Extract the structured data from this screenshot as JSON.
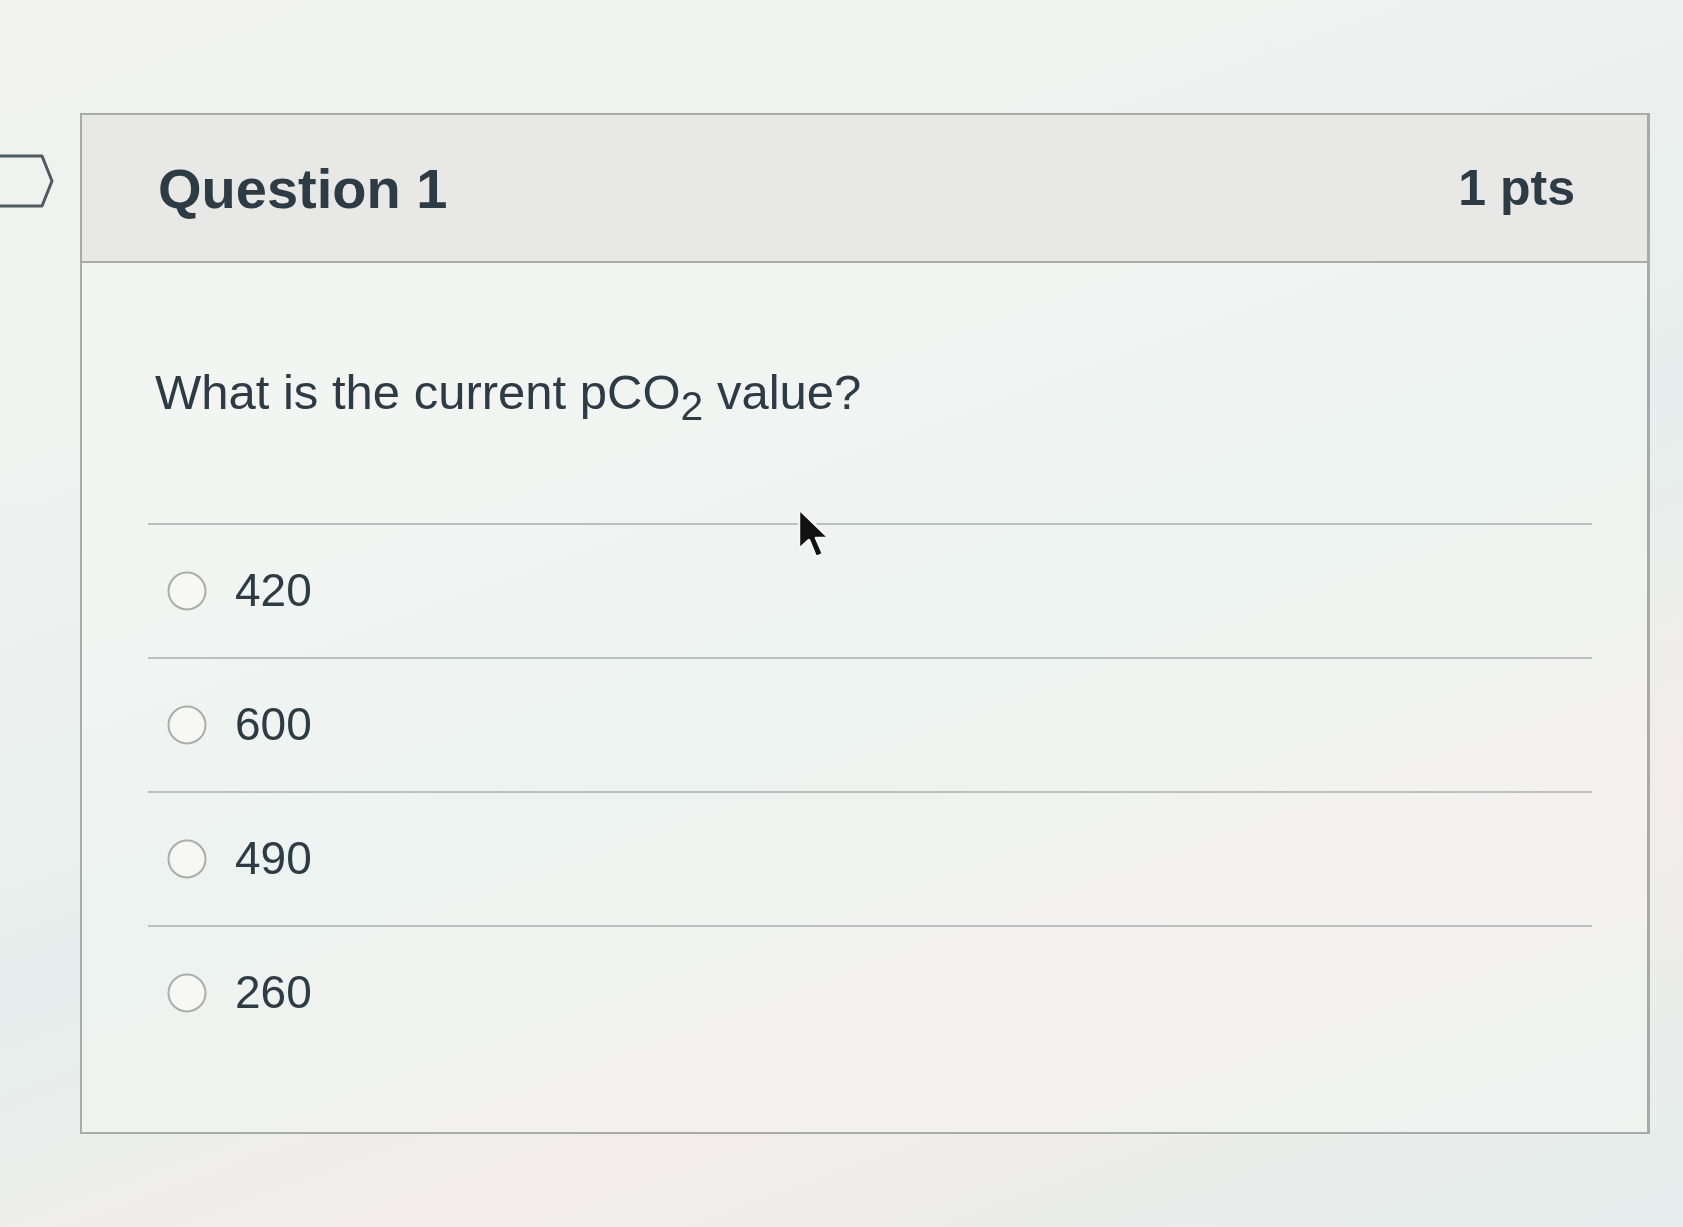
{
  "question": {
    "title": "Question 1",
    "points": "1 pts",
    "text": "What is the current pCO$_{2}$ value?",
    "answers": [
      {
        "label": "420",
        "selected": false
      },
      {
        "label": "600",
        "selected": false
      },
      {
        "label": "490",
        "selected": false
      },
      {
        "label": "260",
        "selected": false
      }
    ]
  }
}
